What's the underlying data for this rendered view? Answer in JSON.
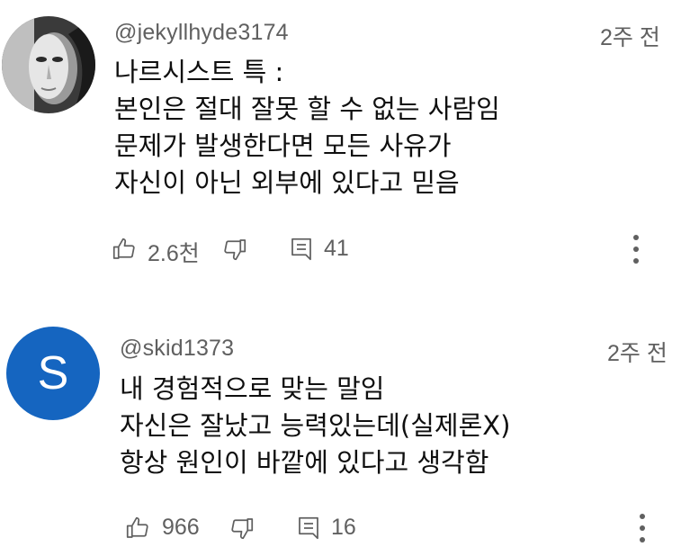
{
  "comments": [
    {
      "author": "@jekyllhyde3174",
      "time": "2주 전",
      "avatar_icon": "mask-icon",
      "lines": [
        "나르시스트 특 :",
        "본인은 절대 잘못 할 수 없는 사람임",
        "문제가 발생한다면 모든 사유가",
        "자신이 아닌 외부에 있다고 믿음"
      ],
      "likes": "2.6천",
      "replies": "41"
    },
    {
      "author": "@skid1373",
      "time": "2주 전",
      "avatar_letter": "S",
      "avatar_color": "#1565c0",
      "lines": [
        "내 경험적으로 맞는 말임",
        "자신은 잘났고 능력있는데(실제론X)",
        "항상 원인이 바깥에 있다고 생각함"
      ],
      "likes": "966",
      "replies": "16"
    }
  ]
}
